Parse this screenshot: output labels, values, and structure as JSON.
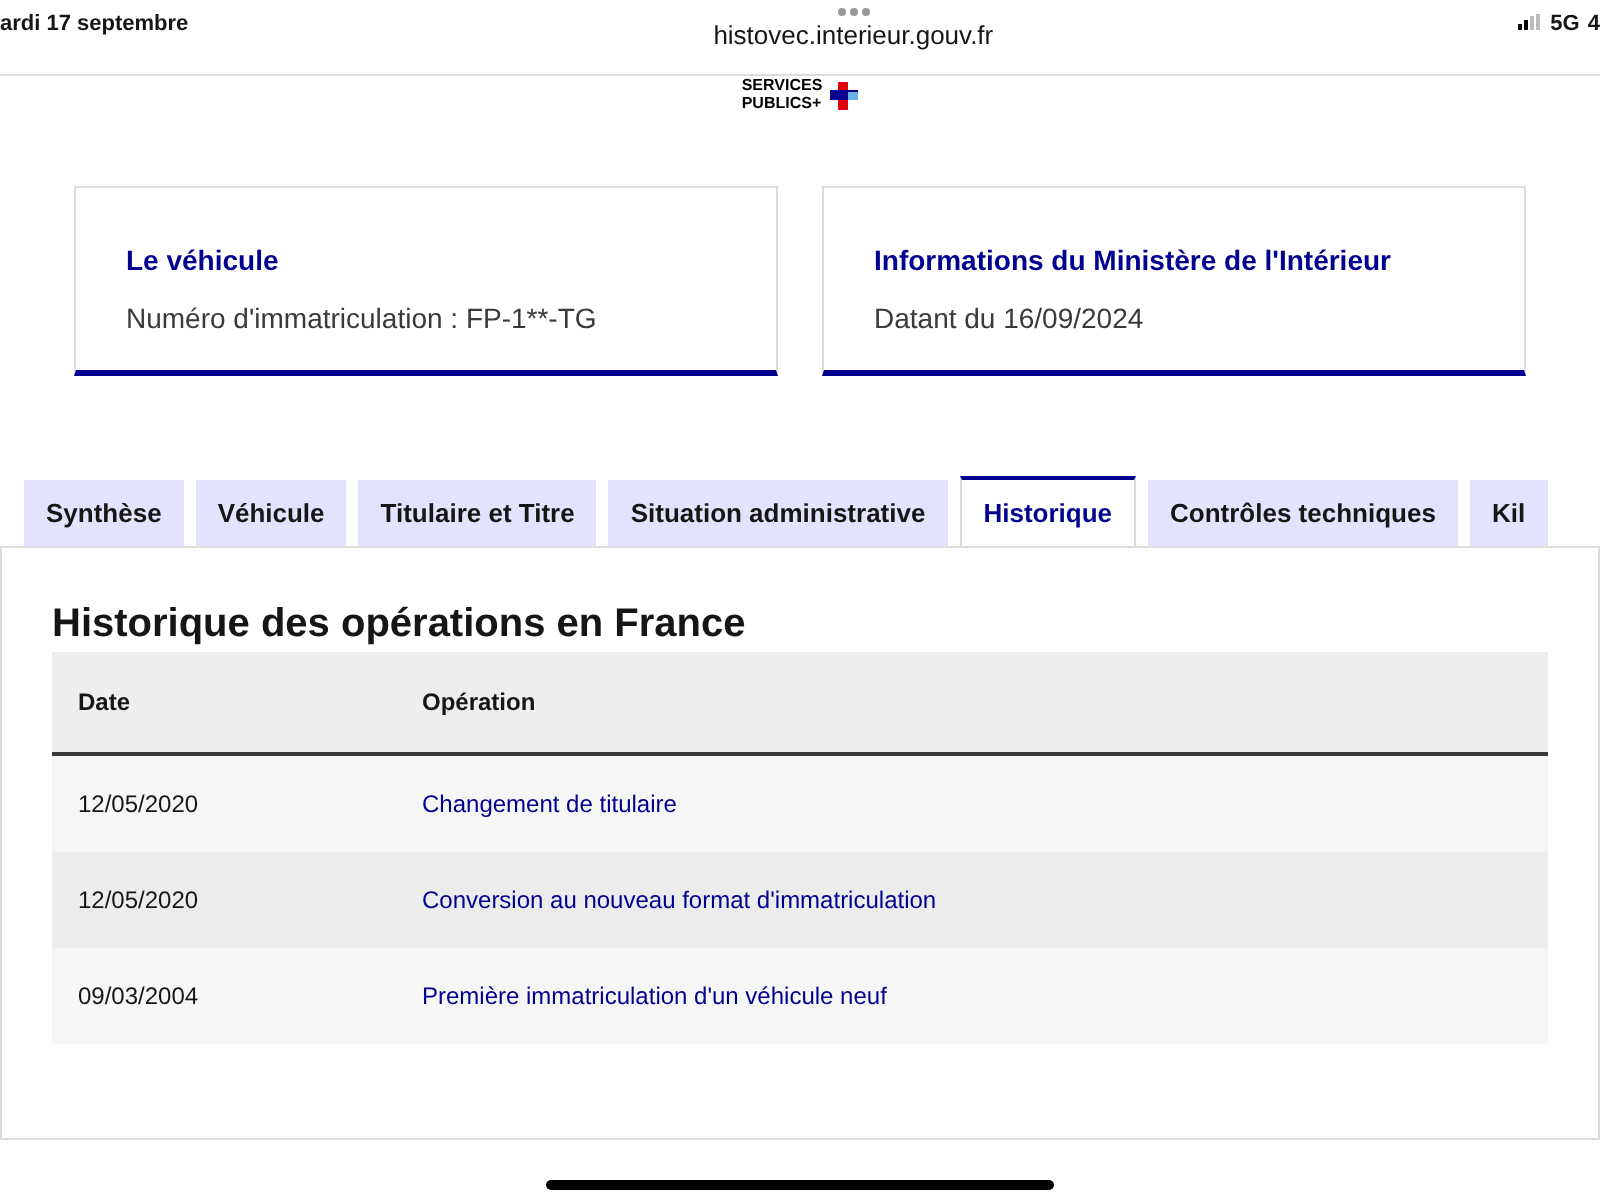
{
  "status_bar": {
    "date": "ardi 17 septembre",
    "url": "histovec.interieur.gouv.fr",
    "network": "5G",
    "battery": "4"
  },
  "logo": {
    "line_1": "SERVICES",
    "line_2": "PUBLICS+"
  },
  "cards": [
    {
      "title": "Le véhicule",
      "text": "Numéro d'immatriculation : FP-1**-TG"
    },
    {
      "title": "Informations du Ministère de l'Intérieur",
      "text": "Datant du 16/09/2024"
    }
  ],
  "tabs": [
    {
      "label": "Synthèse",
      "selected": false
    },
    {
      "label": "Véhicule",
      "selected": false
    },
    {
      "label": "Titulaire et Titre",
      "selected": false
    },
    {
      "label": "Situation administrative",
      "selected": false
    },
    {
      "label": "Historique",
      "selected": true
    },
    {
      "label": "Contrôles techniques",
      "selected": false
    },
    {
      "label": "Kil",
      "selected": false
    }
  ],
  "panel": {
    "title": "Historique des opérations en France",
    "table": {
      "columns": [
        "Date",
        "Opération"
      ],
      "rows": [
        [
          "12/05/2020",
          "Changement de titulaire"
        ],
        [
          "12/05/2020",
          "Conversion au nouveau format d'immatriculation"
        ],
        [
          "09/03/2004",
          "Première immatriculation d'un véhicule neuf"
        ]
      ]
    }
  }
}
